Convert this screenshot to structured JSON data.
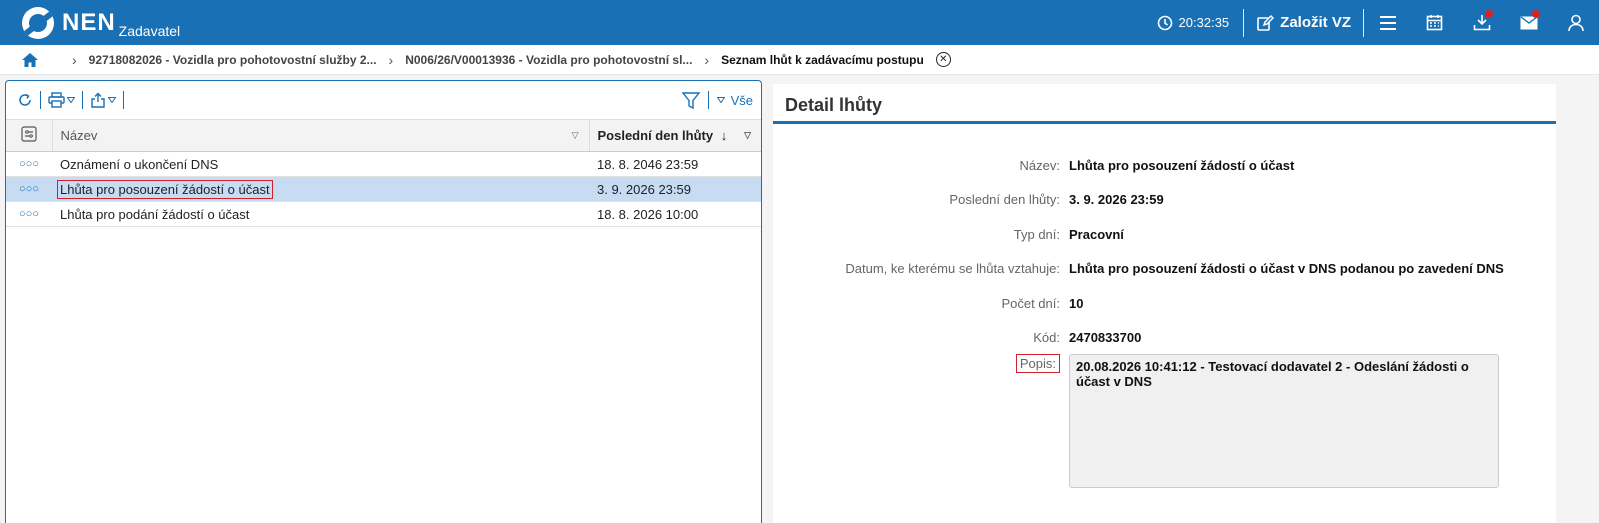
{
  "header": {
    "logo_text": "NEN",
    "logo_subtitle": "Zadavatel",
    "time": "20:32:35",
    "create_label": "Založit VZ",
    "icons": [
      "clock-icon",
      "edit-icon",
      "menu-icon",
      "calendar-icon",
      "download-icon",
      "mail-icon",
      "user-icon"
    ],
    "notification_color": "#e02020",
    "brand_color": "#1a70b4"
  },
  "breadcrumb": {
    "items": [
      "92718082026 - Vozidla pro pohotovostní služby 2...",
      "N006/26/V00013936 - Vozidla pro pohotovostní sl..."
    ],
    "current": "Seznam lhůt k zadávacímu postupu"
  },
  "list": {
    "filter_all_label": "Vše",
    "columns": {
      "name": "Název",
      "date": "Poslední den lhůty"
    },
    "rows": [
      {
        "name": "Oznámení o ukončení DNS",
        "date": "18. 8. 2046 23:59",
        "selected": false
      },
      {
        "name": "Lhůta pro posouzení žádostí o účast",
        "date": "3. 9. 2026 23:59",
        "selected": true
      },
      {
        "name": "Lhůta pro podání žádostí o účast",
        "date": "18. 8. 2026 10:00",
        "selected": false
      }
    ]
  },
  "detail": {
    "title": "Detail lhůty",
    "fields": [
      {
        "label": "Název:",
        "value": "Lhůta pro posouzení žádostí o účast"
      },
      {
        "label": "Poslední den lhůty:",
        "value": "3. 9. 2026 23:59"
      },
      {
        "label": "Typ dní:",
        "value": "Pracovní"
      },
      {
        "label": "Datum, ke kterému se lhůta vztahuje:",
        "value": "Lhůta pro posouzení žádosti o účast v DNS podanou po zavedení DNS"
      },
      {
        "label": "Počet dní:",
        "value": "10"
      },
      {
        "label": "Kód:",
        "value": "2470833700"
      }
    ],
    "description_label": "Popis:",
    "description_value": "20.08.2026 10:41:12 - Testovací dodavatel 2 - Odeslání žádosti o účast v DNS"
  }
}
